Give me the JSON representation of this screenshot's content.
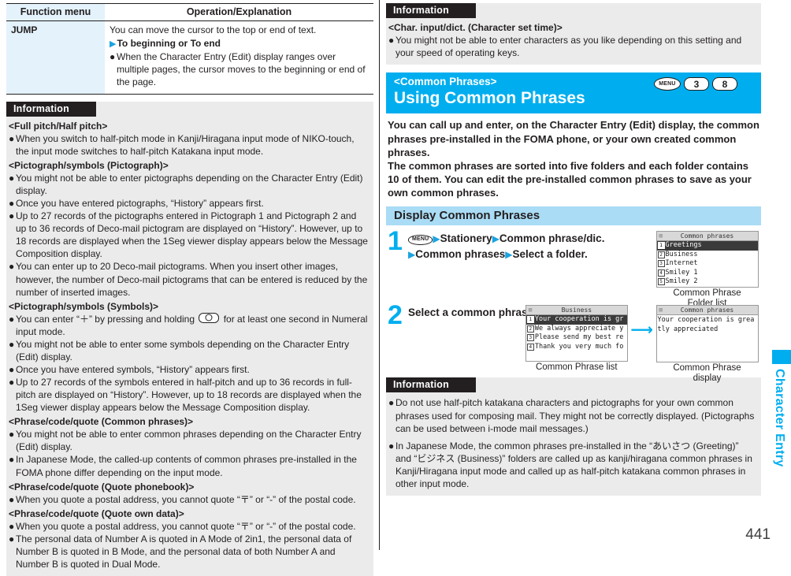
{
  "page": {
    "number": "441",
    "side_tab_label": "Character Entry",
    "accent_cyan": "#00aeef",
    "subbar_blue": "#aadcf5",
    "table_cell_blue": "#e3f2fb",
    "info_gray": "#ebebeb"
  },
  "function_menu_table": {
    "headers": [
      "Function menu",
      "Operation/Explanation"
    ],
    "rows": [
      {
        "menu": "JUMP",
        "lines": [
          {
            "type": "plain",
            "text": "You can move the cursor to the top or end of text."
          },
          {
            "type": "sub",
            "marker": "▶",
            "text": "To beginning or To end"
          },
          {
            "type": "bullet",
            "text": "When the Character Entry (Edit) display ranges over multiple pages, the cursor moves to the beginning or end of the page."
          }
        ]
      }
    ]
  },
  "left_information": {
    "heading": "Information",
    "sections": [
      {
        "title": "<Full pitch/Half pitch>",
        "bullets": [
          "When you switch to half-pitch mode in Kanji/Hiragana input mode of NIKO-touch, the input mode switches to half-pitch Katakana input mode."
        ]
      },
      {
        "title": "<Pictograph/symbols (Pictograph)>",
        "bullets": [
          "You might not be able to enter pictographs depending on the Character Entry (Edit) display.",
          "Once you have entered pictographs, “History” appears first.",
          "Up to 27 records of the pictographs entered in Pictograph 1 and Pictograph 2 and up to 36 records of Deco-mail pictogram are displayed on “History”. However, up to 18 records are displayed when the 1Seg viewer display appears below the Message Composition display.",
          "You can enter up to 20 Deco-mail pictograms. When you insert other images, however, the number of Deco-mail pictograms that can be entered is reduced by the number of inserted images."
        ]
      },
      {
        "title": "<Pictograph/symbols (Symbols)>",
        "bullets_rich": [
          {
            "pre": "You can enter “＋” by pressing and holding ",
            "key_icon": "key-0-icon",
            "post": " for at least one second in Numeral input mode."
          }
        ],
        "bullets": [
          "You might not be able to enter some symbols depending on the Character Entry (Edit) display.",
          "Once you have entered symbols, “History” appears first.",
          "Up to 27 records of the symbols entered in half-pitch and up to 36 records in full-pitch are displayed on “History”. However, up to 18 records are displayed when the 1Seg viewer display appears below the Message Composition display."
        ]
      },
      {
        "title": "<Phrase/code/quote (Common phrases)>",
        "bullets": [
          "You might not be able to enter common phrases depending on the Character Entry (Edit) display.",
          "In Japanese Mode, the called-up contents of common phrases pre-installed in the FOMA phone differ depending on the input mode."
        ]
      },
      {
        "title": "<Phrase/code/quote (Quote phonebook)>",
        "bullets": [
          "When you quote a postal address, you cannot quote “〒” or “-” of the postal code."
        ]
      },
      {
        "title": "<Phrase/code/quote (Quote own data)>",
        "bullets": [
          "When you quote a postal address, you cannot quote “〒” or “-” of the postal code.",
          "The personal data of Number A is quoted in A Mode of 2in1, the personal data of Number B is quoted in B Mode, and the personal data of both Number A and Number B is quoted in Dual Mode."
        ]
      }
    ]
  },
  "right_information_top": {
    "heading": "Information",
    "sections": [
      {
        "title": "<Char. input/dict. (Character set time)>",
        "bullets": [
          "You might not be able to enter characters as you like depending on this setting and your speed of operating keys."
        ]
      }
    ]
  },
  "chapter_banner": {
    "subtitle": "<Common Phrases>",
    "title": "Using Common Phrases",
    "keys": [
      "MENU",
      "3",
      "8"
    ]
  },
  "lead_paragraphs": [
    "You can call up and enter, on the Character Entry (Edit) display, the common phrases pre-installed in the FOMA phone, or your own created common phrases.",
    "The common phrases are sorted into five folders and each folder contains 10 of them. You can edit the pre-installed common phrases to save as your own common phrases."
  ],
  "section_bar": "Display Common Phrases",
  "steps": [
    {
      "number": "1",
      "menu_key": "MENU",
      "parts": [
        "Stationery",
        "Common phrase/dic.",
        "Common phrases",
        "Select a folder."
      ],
      "shots": [
        {
          "title": "Common phrases",
          "type": "list",
          "rows": [
            {
              "num": "1",
              "text": "Greetings",
              "selected": true
            },
            {
              "num": "2",
              "text": "Business",
              "selected": false
            },
            {
              "num": "3",
              "text": "Internet",
              "selected": false
            },
            {
              "num": "4",
              "text": "Smiley 1",
              "selected": false
            },
            {
              "num": "5",
              "text": "Smiley 2",
              "selected": false
            }
          ],
          "caption": "Common Phrase\nFolder list"
        }
      ]
    },
    {
      "number": "2",
      "text": "Select a common phrase.",
      "shots": [
        {
          "title": "Business",
          "type": "list",
          "rows": [
            {
              "num": "1",
              "text": "Your cooperation is gr",
              "selected": true
            },
            {
              "num": "2",
              "text": "We always appreciate y",
              "selected": false
            },
            {
              "num": "3",
              "text": "Please send my best re",
              "selected": false
            },
            {
              "num": "4",
              "text": "Thank you very much fo",
              "selected": false
            }
          ],
          "caption": "Common Phrase list"
        },
        {
          "title": "Common phrases",
          "type": "text",
          "body": "Your cooperation is grea\ntly appreciated",
          "caption": "Common Phrase\ndisplay"
        }
      ]
    }
  ],
  "right_information_bottom": {
    "heading": "Information",
    "bullets": [
      "Do not use half-pitch katakana characters and pictographs for your own common phrases used for composing mail. They might not be correctly displayed. (Pictographs can be used between i-mode mail messages.)",
      "In Japanese Mode, the common phrases pre-installed in the “あいさつ (Greeting)” and “ビジネス (Business)” folders are called up as kanji/hiragana common phrases in Kanji/Hiragana input mode and called up as half-pitch katakana common phrases in other input mode."
    ]
  }
}
